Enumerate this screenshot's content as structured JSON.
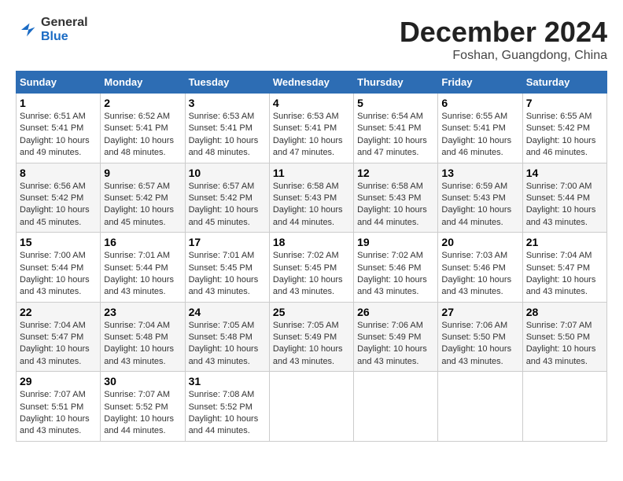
{
  "header": {
    "logo": {
      "general": "General",
      "blue": "Blue"
    },
    "month": "December 2024",
    "location": "Foshan, Guangdong, China"
  },
  "weekdays": [
    "Sunday",
    "Monday",
    "Tuesday",
    "Wednesday",
    "Thursday",
    "Friday",
    "Saturday"
  ],
  "weeks": [
    [
      {
        "day": "1",
        "sunrise": "Sunrise: 6:51 AM",
        "sunset": "Sunset: 5:41 PM",
        "daylight": "Daylight: 10 hours and 49 minutes."
      },
      {
        "day": "2",
        "sunrise": "Sunrise: 6:52 AM",
        "sunset": "Sunset: 5:41 PM",
        "daylight": "Daylight: 10 hours and 48 minutes."
      },
      {
        "day": "3",
        "sunrise": "Sunrise: 6:53 AM",
        "sunset": "Sunset: 5:41 PM",
        "daylight": "Daylight: 10 hours and 48 minutes."
      },
      {
        "day": "4",
        "sunrise": "Sunrise: 6:53 AM",
        "sunset": "Sunset: 5:41 PM",
        "daylight": "Daylight: 10 hours and 47 minutes."
      },
      {
        "day": "5",
        "sunrise": "Sunrise: 6:54 AM",
        "sunset": "Sunset: 5:41 PM",
        "daylight": "Daylight: 10 hours and 47 minutes."
      },
      {
        "day": "6",
        "sunrise": "Sunrise: 6:55 AM",
        "sunset": "Sunset: 5:41 PM",
        "daylight": "Daylight: 10 hours and 46 minutes."
      },
      {
        "day": "7",
        "sunrise": "Sunrise: 6:55 AM",
        "sunset": "Sunset: 5:42 PM",
        "daylight": "Daylight: 10 hours and 46 minutes."
      }
    ],
    [
      {
        "day": "8",
        "sunrise": "Sunrise: 6:56 AM",
        "sunset": "Sunset: 5:42 PM",
        "daylight": "Daylight: 10 hours and 45 minutes."
      },
      {
        "day": "9",
        "sunrise": "Sunrise: 6:57 AM",
        "sunset": "Sunset: 5:42 PM",
        "daylight": "Daylight: 10 hours and 45 minutes."
      },
      {
        "day": "10",
        "sunrise": "Sunrise: 6:57 AM",
        "sunset": "Sunset: 5:42 PM",
        "daylight": "Daylight: 10 hours and 45 minutes."
      },
      {
        "day": "11",
        "sunrise": "Sunrise: 6:58 AM",
        "sunset": "Sunset: 5:43 PM",
        "daylight": "Daylight: 10 hours and 44 minutes."
      },
      {
        "day": "12",
        "sunrise": "Sunrise: 6:58 AM",
        "sunset": "Sunset: 5:43 PM",
        "daylight": "Daylight: 10 hours and 44 minutes."
      },
      {
        "day": "13",
        "sunrise": "Sunrise: 6:59 AM",
        "sunset": "Sunset: 5:43 PM",
        "daylight": "Daylight: 10 hours and 44 minutes."
      },
      {
        "day": "14",
        "sunrise": "Sunrise: 7:00 AM",
        "sunset": "Sunset: 5:44 PM",
        "daylight": "Daylight: 10 hours and 43 minutes."
      }
    ],
    [
      {
        "day": "15",
        "sunrise": "Sunrise: 7:00 AM",
        "sunset": "Sunset: 5:44 PM",
        "daylight": "Daylight: 10 hours and 43 minutes."
      },
      {
        "day": "16",
        "sunrise": "Sunrise: 7:01 AM",
        "sunset": "Sunset: 5:44 PM",
        "daylight": "Daylight: 10 hours and 43 minutes."
      },
      {
        "day": "17",
        "sunrise": "Sunrise: 7:01 AM",
        "sunset": "Sunset: 5:45 PM",
        "daylight": "Daylight: 10 hours and 43 minutes."
      },
      {
        "day": "18",
        "sunrise": "Sunrise: 7:02 AM",
        "sunset": "Sunset: 5:45 PM",
        "daylight": "Daylight: 10 hours and 43 minutes."
      },
      {
        "day": "19",
        "sunrise": "Sunrise: 7:02 AM",
        "sunset": "Sunset: 5:46 PM",
        "daylight": "Daylight: 10 hours and 43 minutes."
      },
      {
        "day": "20",
        "sunrise": "Sunrise: 7:03 AM",
        "sunset": "Sunset: 5:46 PM",
        "daylight": "Daylight: 10 hours and 43 minutes."
      },
      {
        "day": "21",
        "sunrise": "Sunrise: 7:04 AM",
        "sunset": "Sunset: 5:47 PM",
        "daylight": "Daylight: 10 hours and 43 minutes."
      }
    ],
    [
      {
        "day": "22",
        "sunrise": "Sunrise: 7:04 AM",
        "sunset": "Sunset: 5:47 PM",
        "daylight": "Daylight: 10 hours and 43 minutes."
      },
      {
        "day": "23",
        "sunrise": "Sunrise: 7:04 AM",
        "sunset": "Sunset: 5:48 PM",
        "daylight": "Daylight: 10 hours and 43 minutes."
      },
      {
        "day": "24",
        "sunrise": "Sunrise: 7:05 AM",
        "sunset": "Sunset: 5:48 PM",
        "daylight": "Daylight: 10 hours and 43 minutes."
      },
      {
        "day": "25",
        "sunrise": "Sunrise: 7:05 AM",
        "sunset": "Sunset: 5:49 PM",
        "daylight": "Daylight: 10 hours and 43 minutes."
      },
      {
        "day": "26",
        "sunrise": "Sunrise: 7:06 AM",
        "sunset": "Sunset: 5:49 PM",
        "daylight": "Daylight: 10 hours and 43 minutes."
      },
      {
        "day": "27",
        "sunrise": "Sunrise: 7:06 AM",
        "sunset": "Sunset: 5:50 PM",
        "daylight": "Daylight: 10 hours and 43 minutes."
      },
      {
        "day": "28",
        "sunrise": "Sunrise: 7:07 AM",
        "sunset": "Sunset: 5:50 PM",
        "daylight": "Daylight: 10 hours and 43 minutes."
      }
    ],
    [
      {
        "day": "29",
        "sunrise": "Sunrise: 7:07 AM",
        "sunset": "Sunset: 5:51 PM",
        "daylight": "Daylight: 10 hours and 43 minutes."
      },
      {
        "day": "30",
        "sunrise": "Sunrise: 7:07 AM",
        "sunset": "Sunset: 5:52 PM",
        "daylight": "Daylight: 10 hours and 44 minutes."
      },
      {
        "day": "31",
        "sunrise": "Sunrise: 7:08 AM",
        "sunset": "Sunset: 5:52 PM",
        "daylight": "Daylight: 10 hours and 44 minutes."
      },
      null,
      null,
      null,
      null
    ]
  ]
}
